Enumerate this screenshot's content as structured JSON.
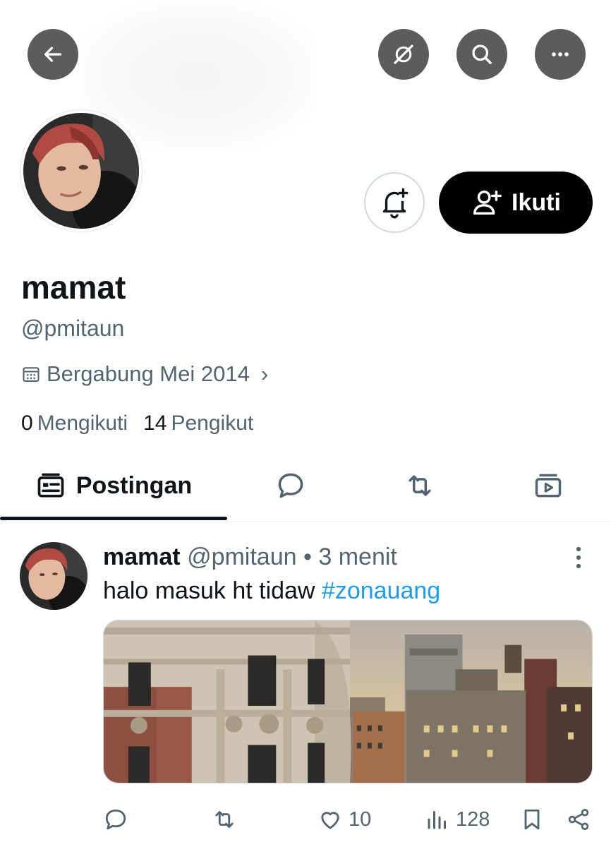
{
  "header": {
    "back_icon": "arrow-left-icon",
    "grok_icon": "grok-icon",
    "search_icon": "search-icon",
    "more_icon": "more-horizontal-icon"
  },
  "profile": {
    "display_name": "mamat",
    "handle": "@pmitaun",
    "joined": "Bergabung Mei 2014",
    "joined_chevron": "›",
    "following_count": "0",
    "following_label": "Mengikuti",
    "followers_count": "14",
    "followers_label": "Pengikut",
    "follow_button_label": "Ikuti",
    "notify_icon": "bell-plus-icon"
  },
  "tabs": [
    {
      "label": "Postingan",
      "icon": "posts-icon",
      "selected": true
    },
    {
      "label": "",
      "icon": "reply-icon",
      "selected": false
    },
    {
      "label": "",
      "icon": "repost-icon",
      "selected": false
    },
    {
      "label": "",
      "icon": "media-icon",
      "selected": false
    }
  ],
  "post": {
    "name": "mamat",
    "handle": "@pmitaun",
    "separator": "•",
    "time": "3 menit",
    "text": "halo masuk ht tidaw ",
    "hashtag": "#zonauang",
    "likes": "10",
    "views": "128"
  },
  "colors": {
    "accent": "#1d9bf0",
    "secondary_text": "#536471",
    "primary_text": "#0f1419"
  }
}
